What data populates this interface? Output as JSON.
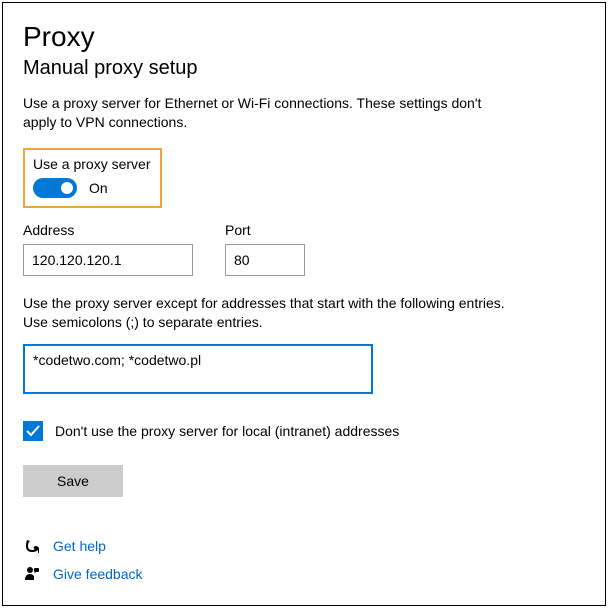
{
  "header": {
    "title": "Proxy",
    "section": "Manual proxy setup"
  },
  "description": "Use a proxy server for Ethernet or Wi-Fi connections. These settings don't apply to VPN connections.",
  "toggle": {
    "label": "Use a proxy server",
    "state": "On"
  },
  "address": {
    "label": "Address",
    "value": "120.120.120.1"
  },
  "port": {
    "label": "Port",
    "value": "80"
  },
  "exceptions": {
    "description": "Use the proxy server except for addresses that start with the following entries. Use semicolons (;) to separate entries.",
    "value": "*codetwo.com; *codetwo.pl"
  },
  "checkbox": {
    "label": "Don't use the proxy server for local (intranet) addresses"
  },
  "save_label": "Save",
  "footer": {
    "help": "Get help",
    "feedback": "Give feedback"
  }
}
